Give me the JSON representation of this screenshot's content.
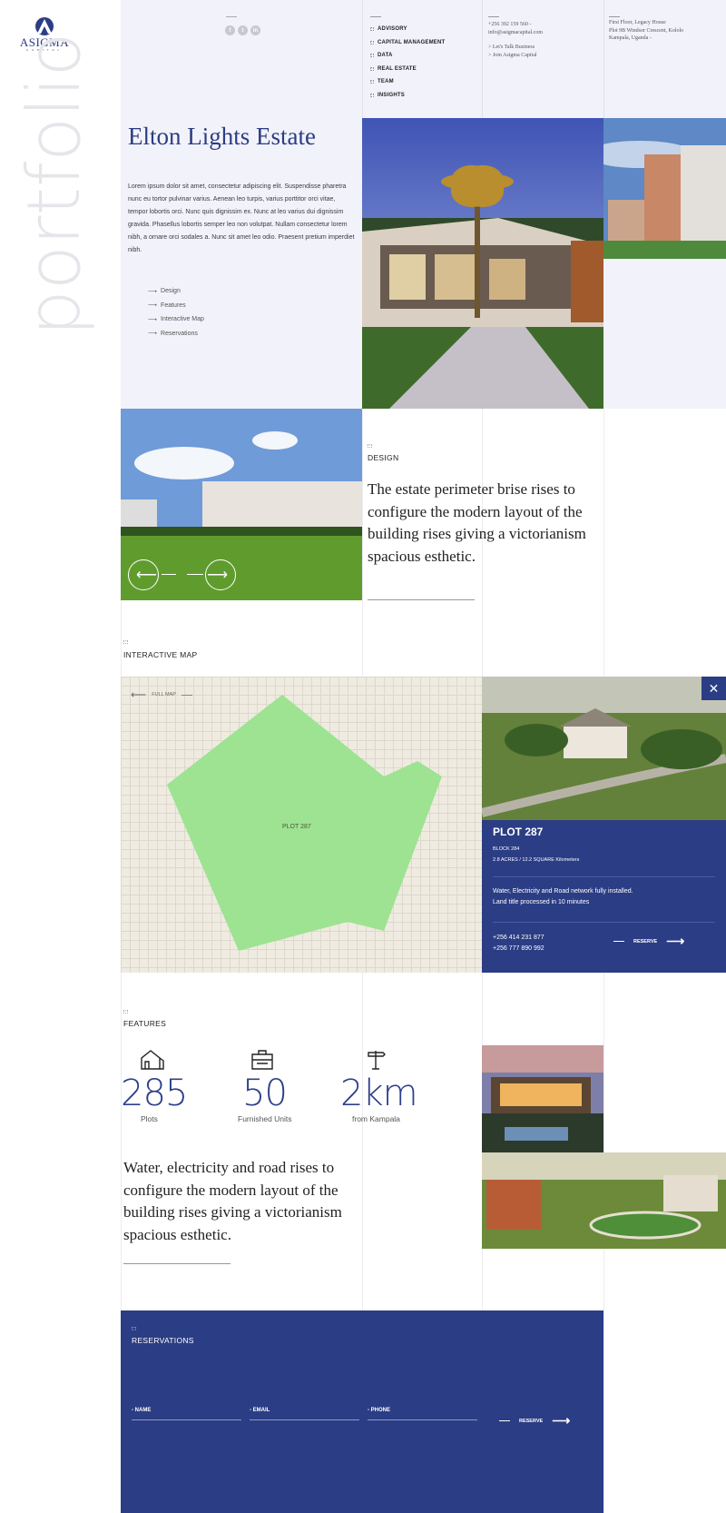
{
  "brand": {
    "name": "ASIGMA",
    "tagline": "CAPITAL",
    "vertical_word": "portfolio"
  },
  "social": [
    "facebook-icon",
    "twitter-icon",
    "linkedin-icon"
  ],
  "nav": {
    "items": [
      "ADVISORY",
      "CAPITAL MANAGEMENT",
      "DATA",
      "REAL ESTATE",
      "TEAM",
      "INSIGHTS"
    ]
  },
  "contact": {
    "phone": "+256 392 159 560 -",
    "email": "info@asigmacapital.com",
    "links": [
      "> Let's Talk Business",
      "> Join Asigma Capital"
    ]
  },
  "address": {
    "line1": "First Floor, Legacy House",
    "line2": "Plot 9B Windsor Crescent, Kololo",
    "line3": "Kampala, Uganda -"
  },
  "hero": {
    "title": "Elton Lights Estate",
    "description": "Lorem ipsum dolor sit amet, consectetur adipiscing elit. Suspendisse pharetra nunc eu tortor pulvinar varius. Aenean leo turpis, varius porttitor orci vitae, tempor lobortis orci. Nunc quis dignissim ex. Nunc at leo varius dui dignissim gravida. Phasellus lobortis semper leo non volutpat. Nullam consectetur lorem nibh, a ornare orci sodales a. Nunc sit amet leo odio. Praesent pretium imperdiet nibh.",
    "links": [
      "Design",
      "Features",
      "Interactive Map",
      "Reservations"
    ]
  },
  "design": {
    "label": "DESIGN",
    "text": "The estate perimeter brise rises to configure the modern layout of the building rises giving a victorianism spacious esthetic."
  },
  "map": {
    "label": "INTERACTIVE MAP",
    "full_map": "FULL MAP",
    "plot_label": "PLOT 287"
  },
  "plot": {
    "title": "PLOT 287",
    "block": "BLOCK 284",
    "size": "2.8 ACRES / 12.2 SQUARE Kilometers",
    "info1": "Water, Electricity and Road network fully installed.",
    "info2": "Land title processed in 10 minutes",
    "phone1": "+256 414 231 877",
    "phone2": "+256 777 890 992",
    "reserve": "RESERVE"
  },
  "features": {
    "label": "FEATURES",
    "items": [
      {
        "icon": "house-icon",
        "value": "285",
        "label": "Plots"
      },
      {
        "icon": "furniture-icon",
        "value": "50",
        "label": "Furnished Units"
      },
      {
        "icon": "signpost-icon",
        "value": "2km",
        "label": "from Kampala"
      }
    ],
    "text": "Water, electricity and road rises to configure the modern layout of the building rises giving a victorianism spacious esthetic."
  },
  "reservations": {
    "label": "RESERVATIONS",
    "name": "- NAME",
    "email": "- EMAIL",
    "phone": "- PHONE",
    "reserve": "RESERVE"
  },
  "colors": {
    "navy": "#2b3d84",
    "lavender": "#f2f2fa",
    "plot_green": "#9de392",
    "map_bg": "#efebe1"
  }
}
